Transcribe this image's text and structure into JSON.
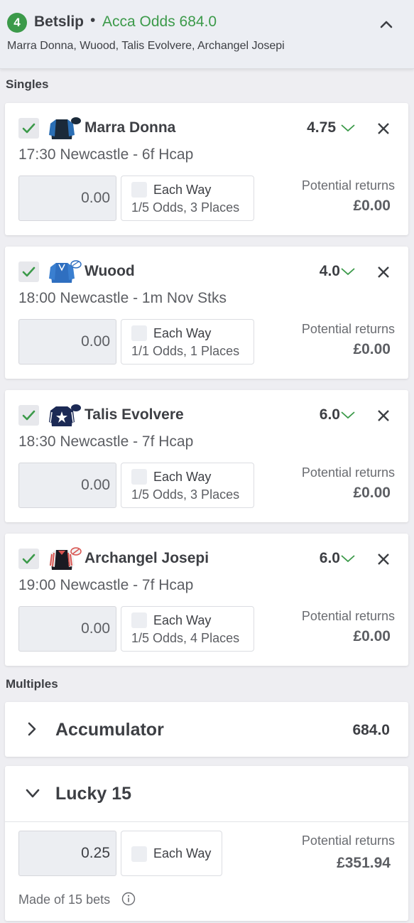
{
  "header": {
    "count": "4",
    "title": "Betslip",
    "separator": "•",
    "acca_odds": "Acca Odds 684.0",
    "selections_summary": "Marra Donna, Wuood, Talis Evolvere, Archangel Josepi"
  },
  "sections": {
    "singles": "Singles",
    "multiples": "Multiples"
  },
  "singles": [
    {
      "runner": "Marra Donna",
      "odds": "4.75",
      "race": "17:30 Newcastle - 6f Hcap",
      "stake_placeholder": "0.00",
      "each_way_label": "Each Way",
      "each_way_terms": "1/5 Odds, 3 Places",
      "returns_label": "Potential returns",
      "returns_value": "£0.00",
      "silk_colors": {
        "body": "#1b2a3a",
        "sleeves": "#2b6fb5",
        "cap": "#1b2a3a"
      }
    },
    {
      "runner": "Wuood",
      "odds": "4.0",
      "race": "18:00 Newcastle - 1m Nov Stks",
      "stake_placeholder": "0.00",
      "each_way_label": "Each Way",
      "each_way_terms": "1/1 Odds, 1 Places",
      "returns_label": "Potential returns",
      "returns_value": "£0.00",
      "silk_colors": {
        "body": "#2f6fc0",
        "sleeves": "#2f6fc0",
        "cap": "#ffffff"
      }
    },
    {
      "runner": "Talis Evolvere",
      "odds": "6.0",
      "race": "18:30 Newcastle - 7f Hcap",
      "stake_placeholder": "0.00",
      "each_way_label": "Each Way",
      "each_way_terms": "1/5 Odds, 3 Places",
      "returns_label": "Potential returns",
      "returns_value": "£0.00",
      "silk_colors": {
        "body": "#1c2a55",
        "sleeves": "#1c2a55",
        "cap": "#1c2a55"
      }
    },
    {
      "runner": "Archangel Josepi",
      "odds": "6.0",
      "race": "19:00 Newcastle - 7f Hcap",
      "stake_placeholder": "0.00",
      "each_way_label": "Each Way",
      "each_way_terms": "1/5 Odds, 4 Places",
      "returns_label": "Potential returns",
      "returns_value": "£0.00",
      "silk_colors": {
        "body": "#1a1a22",
        "sleeves": "#d9534f",
        "cap": "#d9534f"
      }
    }
  ],
  "multiples": {
    "accumulator": {
      "title": "Accumulator",
      "odds": "684.0"
    },
    "lucky15": {
      "title": "Lucky 15",
      "stake": "0.25",
      "each_way_label": "Each Way",
      "returns_label": "Potential returns",
      "returns_value": "£351.94",
      "made_of": "Made of 15 bets"
    }
  },
  "colors": {
    "accent_green": "#3c9a4a",
    "text_dark": "#3d3f44",
    "background": "#eeeef2"
  }
}
